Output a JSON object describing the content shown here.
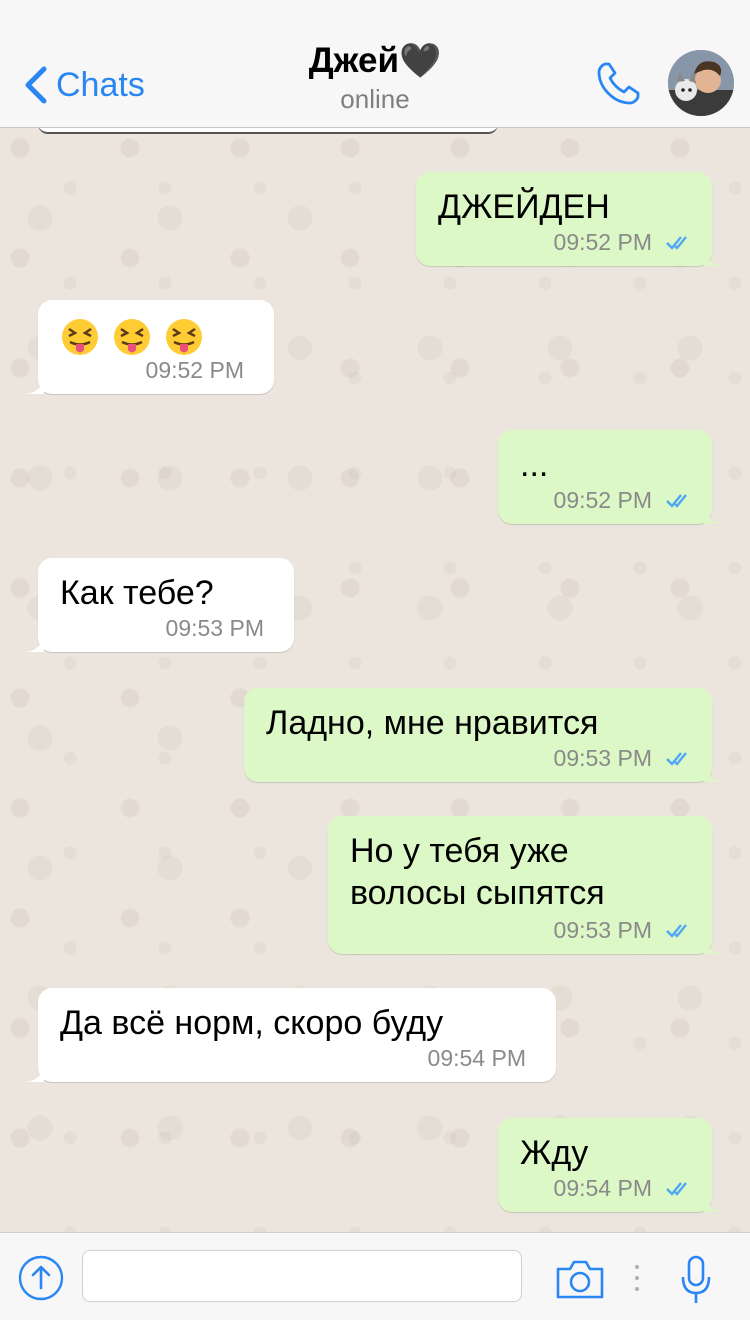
{
  "header": {
    "back_label": "Chats",
    "title": "Джей",
    "title_emoji": "🖤",
    "status": "online"
  },
  "messages": [
    {
      "direction": "out",
      "text": "ДЖЕЙДЕН",
      "time": "09:52 PM",
      "read": true
    },
    {
      "direction": "in",
      "text": "😝😝😝",
      "emoji_icon": "squinting-tongue-face-icon",
      "time": "09:52 PM"
    },
    {
      "direction": "out",
      "text": "...",
      "time": "09:52 PM",
      "read": true
    },
    {
      "direction": "in",
      "text": "Как тебе?",
      "time": "09:53 PM"
    },
    {
      "direction": "out",
      "text": "Ладно, мне нравится",
      "time": "09:53 PM",
      "read": true
    },
    {
      "direction": "out",
      "text": "Но у тебя уже волосы сыпятся",
      "time": "09:53 PM",
      "read": true
    },
    {
      "direction": "in",
      "text": "Да всё норм, скоро буду",
      "time": "09:54 PM"
    },
    {
      "direction": "out",
      "text": "Жду",
      "time": "09:54 PM",
      "read": true
    }
  ],
  "composer": {
    "value": "",
    "placeholder": ""
  },
  "colors": {
    "accent": "#2a86f2",
    "outgoing_bubble": "#dcf8c6",
    "incoming_bubble": "#ffffff",
    "chat_background": "#ece5dd",
    "read_ticks": "#4fa8f5"
  }
}
